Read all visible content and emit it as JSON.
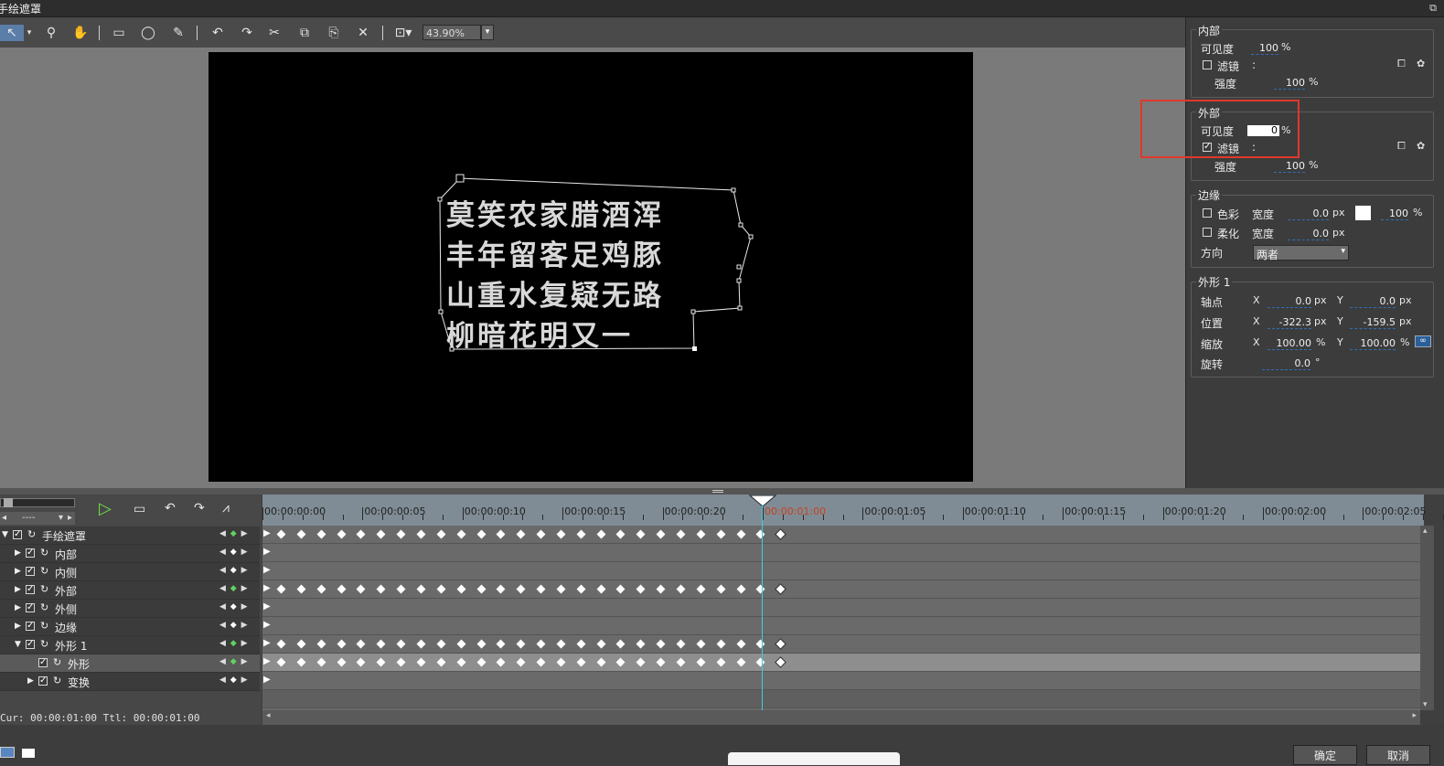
{
  "window": {
    "title": "手绘遮罩"
  },
  "toolbar": {
    "zoom_value": "43.90%"
  },
  "preview": {
    "lines": [
      "莫笑农家腊酒浑",
      "丰年留客足鸡豚",
      "山重水复疑无路",
      "柳暗花明又一"
    ]
  },
  "panel": {
    "inner": {
      "title": "内部",
      "visibility_label": "可见度",
      "visibility_value": "100",
      "filter_label": "滤镜",
      "filter_colon": ":",
      "strength_label": "强度",
      "strength_value": "100"
    },
    "outer": {
      "title": "外部",
      "visibility_label": "可见度",
      "visibility_value": "0",
      "filter_label": "滤镜",
      "filter_colon": ":",
      "strength_label": "强度",
      "strength_value": "100"
    },
    "edge": {
      "title": "边缘",
      "color_label": "色彩",
      "width_label": "宽度",
      "color_width_value": "0.0",
      "color_percent": "100",
      "soft_label": "柔化",
      "soft_width_value": "0.0",
      "direction_label": "方向",
      "direction_value": "两者"
    },
    "shape": {
      "title": "外形 1",
      "pivot_label": "轴点",
      "pivot_x": "0.0",
      "pivot_y": "0.0",
      "position_label": "位置",
      "position_x": "-322.3",
      "position_y": "-159.5",
      "scale_label": "缩放",
      "scale_x": "100.00",
      "scale_y": "100.00",
      "rotate_label": "旋转",
      "rotate_value": "0.0"
    },
    "units": {
      "percent": "%",
      "px": "px",
      "deg": "°",
      "x": "X",
      "y": "Y"
    }
  },
  "timeline": {
    "ruler_labels": [
      "00:00:00:00",
      "00:00:00:05",
      "00:00:00:10",
      "00:00:00:15",
      "00:00:00:20",
      "00:00:01:00",
      "00:00:01:05",
      "00:00:01:10",
      "00:00:01:15",
      "00:00:01:20",
      "00:00:02:00",
      "00:00:02:05"
    ],
    "tracks": [
      {
        "label": "手绘遮罩",
        "indent": 0,
        "keys": true
      },
      {
        "label": "内部",
        "indent": 1,
        "keys": false
      },
      {
        "label": "内侧",
        "indent": 1,
        "keys": false
      },
      {
        "label": "外部",
        "indent": 1,
        "keys": true
      },
      {
        "label": "外侧",
        "indent": 1,
        "keys": false
      },
      {
        "label": "边缘",
        "indent": 1,
        "keys": false
      },
      {
        "label": "外形 1",
        "indent": 1,
        "keys": true
      },
      {
        "label": "外形",
        "indent": 2,
        "keys": true
      },
      {
        "label": "变换",
        "indent": 2,
        "keys": false
      }
    ],
    "dropdown_value": "----",
    "status": "Cur: 00:00:01:00  Ttl: 00:00:01:00"
  },
  "buttons": {
    "ok": "确定",
    "cancel": "取消"
  }
}
